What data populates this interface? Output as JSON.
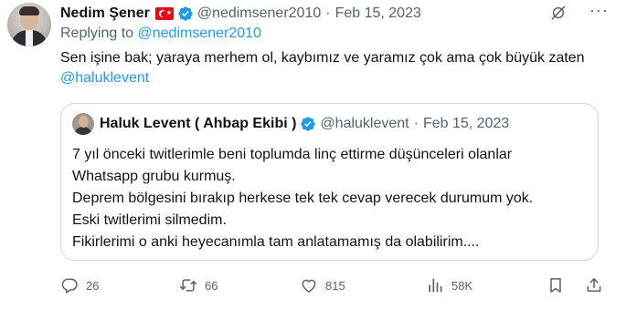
{
  "author": {
    "name": "Nedim Şener",
    "handle": "@nedimsener2010",
    "date": "Feb 15, 2023",
    "separator": "·"
  },
  "reply": {
    "prefix": "Replying to ",
    "to": "@nedimsener2010"
  },
  "tweet": {
    "text": "Sen işine bak; yaraya merhem ol, kaybımız ve yaramız çok ama çok büyük zaten ",
    "mention": "@haluklevent"
  },
  "quote": {
    "name": "Haluk Levent ( Ahbap Ekibi )",
    "handle": "@haluklevent",
    "date": "Feb 15, 2023",
    "separator": "·",
    "lines": [
      "7 yıl önceki twitlerimle beni toplumda linç ettirme düşünceleri olanlar",
      "Whatsapp grubu kurmuş.",
      "Deprem bölgesini bırakıp herkese tek tek cevap verecek durumum yok.",
      "Eski twitlerimi silmedim.",
      "Fikirlerimi o anki heyecanımla tam anlatamamış da olabilirim...."
    ]
  },
  "actions": {
    "replies": "26",
    "retweets": "66",
    "likes": "815",
    "views": "58K"
  },
  "icons": {
    "flag": "turkey-flag-icon",
    "verified": "verified-badge-icon",
    "grok": "grok-icon",
    "more": "more-icon",
    "reply": "reply-icon",
    "retweet": "retweet-icon",
    "like": "heart-icon",
    "views": "views-icon",
    "bookmark": "bookmark-icon",
    "share": "share-icon"
  },
  "colors": {
    "link": "#1d9bf0",
    "secondary": "#536471",
    "text": "#0f1419",
    "verified": "#1d9bf0",
    "border": "#cfd9de"
  }
}
